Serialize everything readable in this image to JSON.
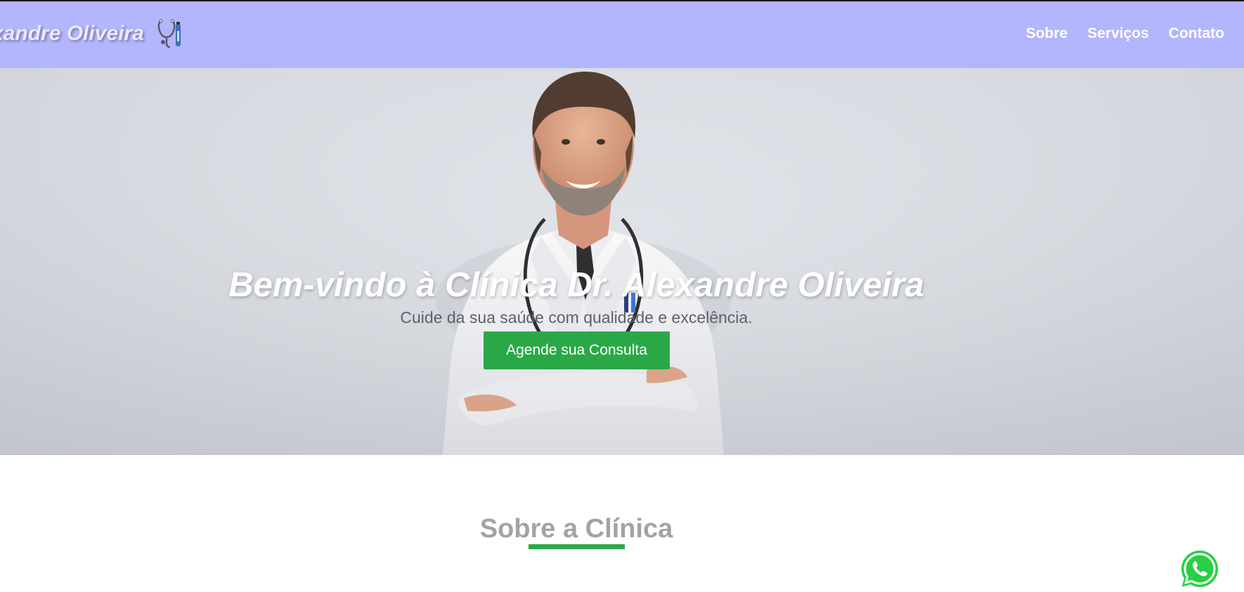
{
  "header": {
    "brand": "xandre Oliveira",
    "brand_icon": "stethoscope-thermometer-icon",
    "background": "#b3b5fd",
    "nav": [
      {
        "label": "Sobre"
      },
      {
        "label": "Serviços"
      },
      {
        "label": "Contato"
      }
    ]
  },
  "hero": {
    "title": "Bem-vindo à Clínica Dr. Alexandre Oliveira",
    "subtitle": "Cuide da sua saúde com qualidade e excelência.",
    "cta_label": "Agende sua Consulta",
    "image": "smiling-doctor-photo",
    "accent": "#2aa847"
  },
  "about": {
    "title": "Sobre a Clínica"
  },
  "floating": {
    "whatsapp_icon": "whatsapp-icon"
  }
}
